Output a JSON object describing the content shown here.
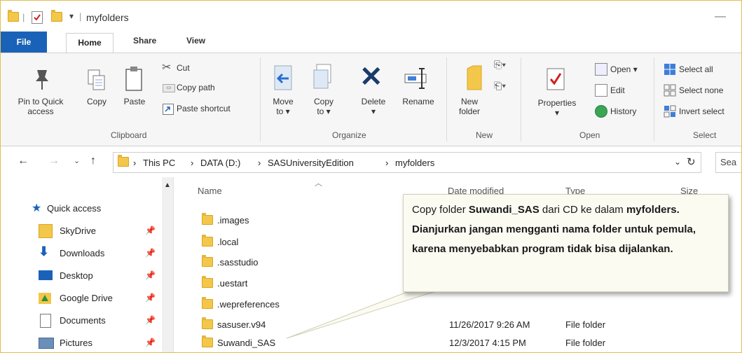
{
  "window": {
    "title": "myfolders",
    "qat_arrow": "▾",
    "title_separator": "|",
    "minimize": "—"
  },
  "tabs": [
    "File",
    "Home",
    "Share",
    "View"
  ],
  "ribbon": {
    "clipboard": {
      "group": "Clipboard",
      "pin": "Pin to Quick\naccess",
      "copy": "Copy",
      "paste": "Paste",
      "cut": "Cut",
      "copy_path": "Copy path",
      "paste_shortcut": "Paste shortcut"
    },
    "organize": {
      "group": "Organize",
      "move_to": "Move\nto ▾",
      "copy_to": "Copy\nto ▾",
      "delete": "Delete\n▾",
      "rename": "Rename"
    },
    "new": {
      "group": "New",
      "new_folder": "New\nfolder"
    },
    "open": {
      "group": "Open",
      "properties": "Properties\n▾",
      "open": "Open ▾",
      "edit": "Edit",
      "history": "History"
    },
    "select": {
      "group": "Select",
      "select_all": "Select all",
      "select_none": "Select none",
      "invert": "Invert select"
    }
  },
  "address": {
    "crumbs": [
      "This PC",
      "DATA (D:)",
      "SASUniversityEdition",
      "myfolders"
    ],
    "separator": "›",
    "search_placeholder": "Sea"
  },
  "nav": {
    "items": [
      {
        "label": "Quick access",
        "icon": "star-icon",
        "pinned": false
      },
      {
        "label": "SkyDrive",
        "icon": "folder-icon",
        "pinned": true
      },
      {
        "label": "Downloads",
        "icon": "download-icon",
        "pinned": true
      },
      {
        "label": "Desktop",
        "icon": "desktop-icon",
        "pinned": true
      },
      {
        "label": "Google Drive",
        "icon": "google-drive-icon",
        "pinned": true
      },
      {
        "label": "Documents",
        "icon": "documents-icon",
        "pinned": true
      },
      {
        "label": "Pictures",
        "icon": "pictures-icon",
        "pinned": true
      }
    ]
  },
  "columns": {
    "name": "Name",
    "date": "Date modified",
    "type": "Type",
    "size": "Size"
  },
  "files": [
    {
      "name": ".images",
      "date": "",
      "type": ""
    },
    {
      "name": ".local",
      "date": "",
      "type": ""
    },
    {
      "name": ".sasstudio",
      "date": "",
      "type": ""
    },
    {
      "name": ".uestart",
      "date": "",
      "type": ""
    },
    {
      "name": ".wepreferences",
      "date": "",
      "type": ""
    },
    {
      "name": "sasuser.v94",
      "date": "11/26/2017 9:26 AM",
      "type": "File folder"
    },
    {
      "name": "Suwandi_SAS",
      "date": "12/3/2017 4:15 PM",
      "type": "File folder"
    }
  ],
  "callout": {
    "part1": "Copy folder ",
    "bold1": "Suwandi_SAS",
    "part2": " dari CD ke dalam ",
    "bold2": "myfolders.  Dianjurkan jangan mengganti nama folder untuk pemula, karena menyebabkan program tidak bisa dijalankan."
  },
  "colors": {
    "file_tab": "#1a62b8",
    "folder": "#f3c74a",
    "callout_bg": "#fbfbf2"
  }
}
